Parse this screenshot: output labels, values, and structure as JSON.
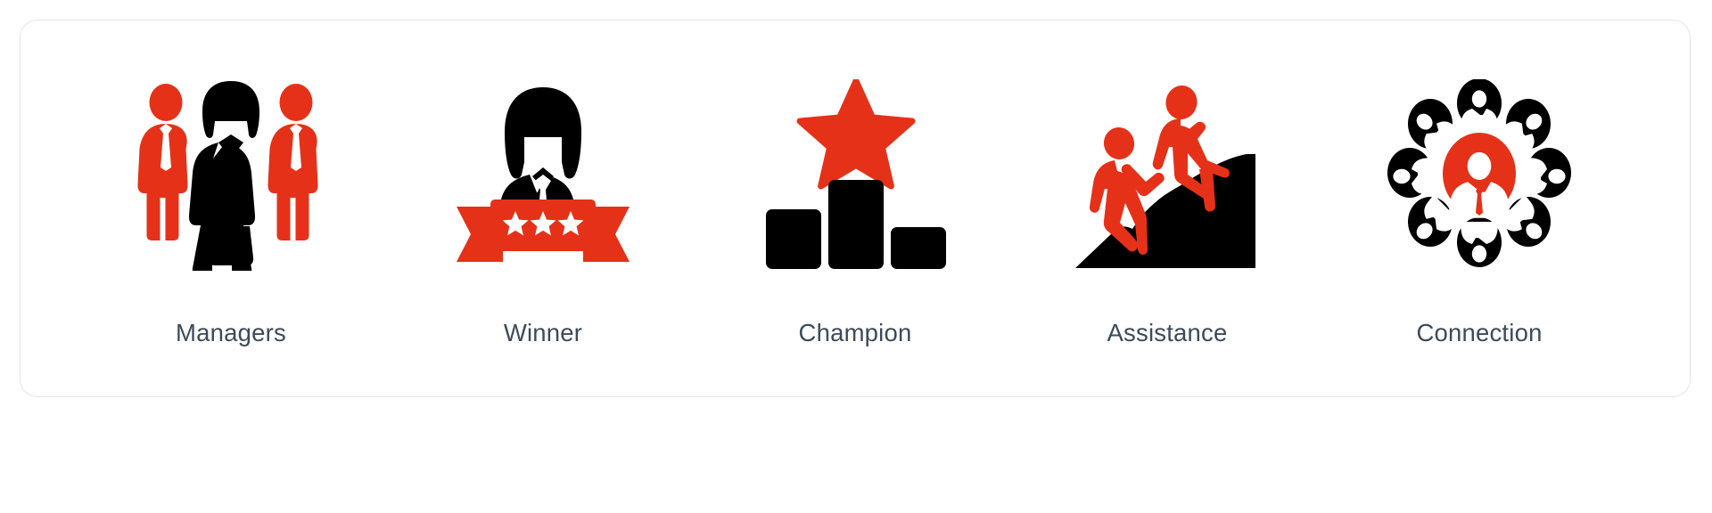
{
  "card": {
    "background": "#ffffff",
    "border_color": "#e4e6e8"
  },
  "palette": {
    "red": "#E63119",
    "black": "#000000",
    "label_text": "#3c4a5a",
    "white": "#ffffff"
  },
  "items": [
    {
      "id": "managers",
      "label": "Managers",
      "icon_name": "managers-group-icon",
      "description": "Three standing business figures: two red male figures with neckties flanking a central black female figure in a dress"
    },
    {
      "id": "winner",
      "label": "Winner",
      "icon_name": "winner-ribbon-icon",
      "description": "Black businesswoman bust above a red ribbon banner containing three white stars"
    },
    {
      "id": "champion",
      "label": "Champion",
      "icon_name": "champion-podium-icon",
      "description": "Three black podium bars with a red five-pointed star above the tallest centre bar"
    },
    {
      "id": "assistance",
      "label": "Assistance",
      "icon_name": "assistance-helping-hand-icon",
      "description": "Two red figures on a black mountain slope, the upper one reaching down to pull the lower one up"
    },
    {
      "id": "connection",
      "label": "Connection",
      "icon_name": "connection-network-icon",
      "description": "Central red circle with a white businessman silhouette surrounded by eight black circles each holding a rotated businessman silhouette"
    }
  ]
}
